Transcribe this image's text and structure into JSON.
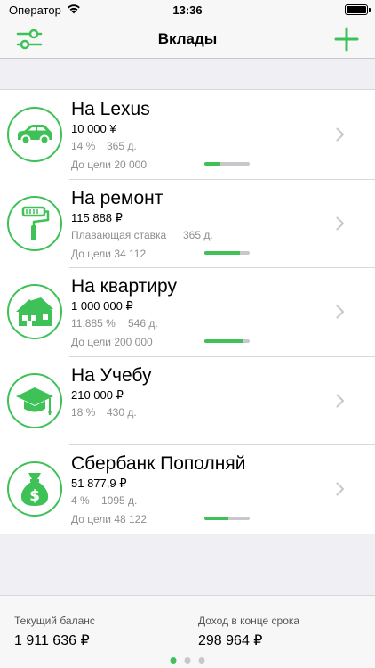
{
  "status_bar": {
    "carrier": "Оператор",
    "time": "13:36"
  },
  "nav": {
    "title": "Вклады",
    "left_icon": "sliders-icon",
    "right_icon": "plus-icon"
  },
  "colors": {
    "accent": "#3ec156",
    "track": "#c7c7cc"
  },
  "deposits": [
    {
      "icon": "car-icon",
      "title": "На Lexus",
      "amount": "10 000 ¥",
      "rate": "14 %",
      "term": "365 д.",
      "goal": "До цели 20 000",
      "progress": 0.35
    },
    {
      "icon": "paint-roller-icon",
      "title": "На ремонт",
      "amount": "115 888 ₽",
      "rate": "Плавающая ставка",
      "term": "365 д.",
      "goal": "До цели 34 112",
      "progress": 0.78
    },
    {
      "icon": "house-icon",
      "title": "На квартиру",
      "amount": "1 000 000 ₽",
      "rate": "11,885 %",
      "term": "546 д.",
      "goal": "До цели 200 000",
      "progress": 0.84
    },
    {
      "icon": "graduation-cap-icon",
      "title": "На Учебу",
      "amount": "210 000 ₽",
      "rate": "18 %",
      "term": "430 д.",
      "goal": "",
      "progress": null
    },
    {
      "icon": "money-bag-icon",
      "title": "Сбербанк Пополняй",
      "amount": "51 877,9 ₽",
      "rate": "4 %",
      "term": "1095 д.",
      "goal": "До цели 48 122",
      "progress": 0.52
    }
  ],
  "footer": {
    "balance_label": "Текущий баланс",
    "balance_value": "1 911 636 ₽",
    "income_label": "Доход в конце срока",
    "income_value": "298 964 ₽",
    "pages_total": 3,
    "page_active": 1
  }
}
